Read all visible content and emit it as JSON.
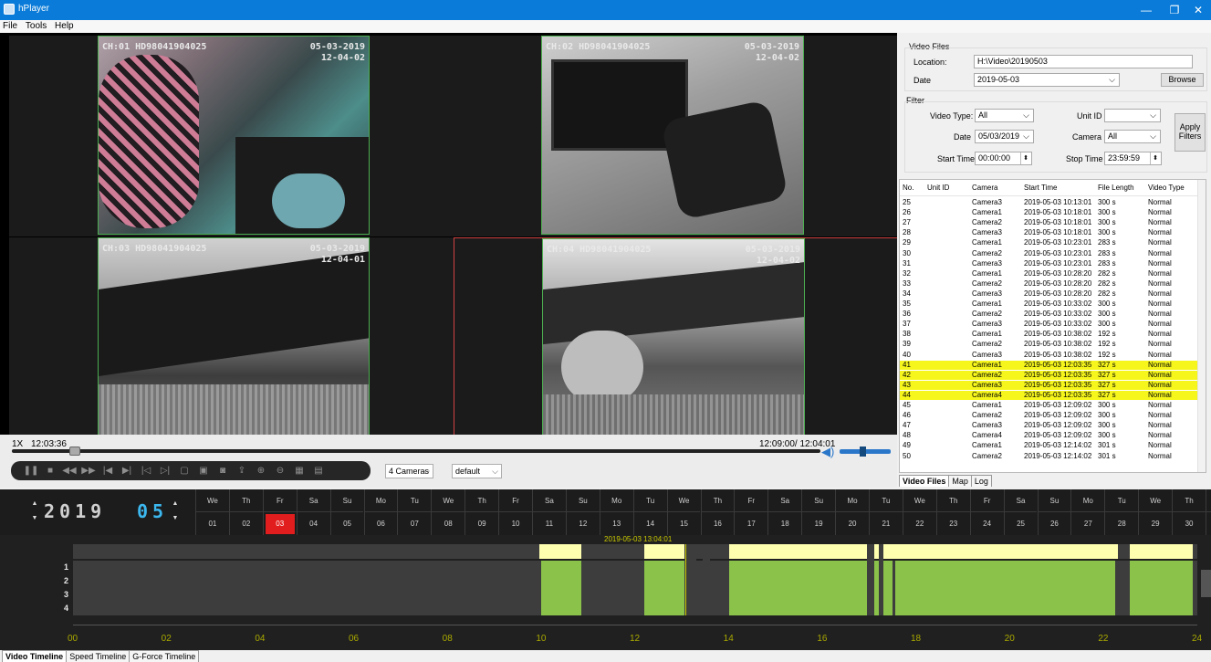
{
  "window": {
    "title": "hPlayer",
    "minimize": "—",
    "restore": "❐",
    "close": "✕"
  },
  "menu": [
    "File",
    "Tools",
    "Help"
  ],
  "cameras": [
    {
      "osd": "CH:01 HD98041904025",
      "date": "05-03-2019",
      "time": "12-04-02"
    },
    {
      "osd": "CH:02 HD98041904025",
      "date": "05-03-2019",
      "time": "12-04-02"
    },
    {
      "osd": "CH:03 HD98041904025",
      "date": "05-03-2019",
      "time": "12-04-01"
    },
    {
      "osd": "CH:04 HD98041904025",
      "date": "05-03-2019",
      "time": "12-04-02"
    }
  ],
  "playback": {
    "speed": "1X",
    "current_time": "12:03:36",
    "range": "12:09:00/ 12:04:01",
    "camera_mode": "4 Cameras",
    "layout": "default",
    "transport_icons": [
      "pause-icon",
      "stop-icon",
      "rewind-icon",
      "fast-forward-icon",
      "prev-file-icon",
      "next-file-icon",
      "step-back-icon",
      "step-forward-icon",
      "fullscreen-icon",
      "snapshot-icon",
      "camera-icon",
      "export-icon",
      "zoom-in-icon",
      "zoom-out-icon",
      "grid-icon",
      "settings-icon"
    ]
  },
  "video_files": {
    "section": "Video Files",
    "location_label": "Location:",
    "location_value": "H:\\Video\\20190503",
    "date_label": "Date",
    "date_value": "2019-05-03",
    "browse": "Browse"
  },
  "filter": {
    "section": "Filter",
    "video_type_label": "Video Type:",
    "video_type_value": "All",
    "unit_id_label": "Unit ID",
    "unit_id_value": "",
    "date_label": "Date",
    "date_value": "05/03/2019",
    "camera_label": "Camera",
    "camera_value": "All",
    "start_time_label": "Start Time",
    "start_time_value": "00:00:00",
    "stop_time_label": "Stop Time",
    "stop_time_value": "23:59:59",
    "apply": "Apply Filters"
  },
  "table": {
    "headers": [
      "No.",
      "Unit ID",
      "Camera",
      "Start Time",
      "File Length",
      "Video Type"
    ],
    "rows": [
      [
        "25",
        "",
        "Camera3",
        "2019-05-03 10:13:01",
        "300 s",
        "Normal"
      ],
      [
        "26",
        "",
        "Camera1",
        "2019-05-03 10:18:01",
        "300 s",
        "Normal"
      ],
      [
        "27",
        "",
        "Camera2",
        "2019-05-03 10:18:01",
        "300 s",
        "Normal"
      ],
      [
        "28",
        "",
        "Camera3",
        "2019-05-03 10:18:01",
        "300 s",
        "Normal"
      ],
      [
        "29",
        "",
        "Camera1",
        "2019-05-03 10:23:01",
        "283 s",
        "Normal"
      ],
      [
        "30",
        "",
        "Camera2",
        "2019-05-03 10:23:01",
        "283 s",
        "Normal"
      ],
      [
        "31",
        "",
        "Camera3",
        "2019-05-03 10:23:01",
        "283 s",
        "Normal"
      ],
      [
        "32",
        "",
        "Camera1",
        "2019-05-03 10:28:20",
        "282 s",
        "Normal"
      ],
      [
        "33",
        "",
        "Camera2",
        "2019-05-03 10:28:20",
        "282 s",
        "Normal"
      ],
      [
        "34",
        "",
        "Camera3",
        "2019-05-03 10:28:20",
        "282 s",
        "Normal"
      ],
      [
        "35",
        "",
        "Camera1",
        "2019-05-03 10:33:02",
        "300 s",
        "Normal"
      ],
      [
        "36",
        "",
        "Camera2",
        "2019-05-03 10:33:02",
        "300 s",
        "Normal"
      ],
      [
        "37",
        "",
        "Camera3",
        "2019-05-03 10:33:02",
        "300 s",
        "Normal"
      ],
      [
        "38",
        "",
        "Camera1",
        "2019-05-03 10:38:02",
        "192 s",
        "Normal"
      ],
      [
        "39",
        "",
        "Camera2",
        "2019-05-03 10:38:02",
        "192 s",
        "Normal"
      ],
      [
        "40",
        "",
        "Camera3",
        "2019-05-03 10:38:02",
        "192 s",
        "Normal"
      ],
      [
        "41",
        "",
        "Camera1",
        "2019-05-03 12:03:35",
        "327 s",
        "Normal"
      ],
      [
        "42",
        "",
        "Camera2",
        "2019-05-03 12:03:35",
        "327 s",
        "Normal"
      ],
      [
        "43",
        "",
        "Camera3",
        "2019-05-03 12:03:35",
        "327 s",
        "Normal"
      ],
      [
        "44",
        "",
        "Camera4",
        "2019-05-03 12:03:35",
        "327 s",
        "Normal"
      ],
      [
        "45",
        "",
        "Camera1",
        "2019-05-03 12:09:02",
        "300 s",
        "Normal"
      ],
      [
        "46",
        "",
        "Camera2",
        "2019-05-03 12:09:02",
        "300 s",
        "Normal"
      ],
      [
        "47",
        "",
        "Camera3",
        "2019-05-03 12:09:02",
        "300 s",
        "Normal"
      ],
      [
        "48",
        "",
        "Camera4",
        "2019-05-03 12:09:02",
        "300 s",
        "Normal"
      ],
      [
        "49",
        "",
        "Camera1",
        "2019-05-03 12:14:02",
        "301 s",
        "Normal"
      ],
      [
        "50",
        "",
        "Camera2",
        "2019-05-03 12:14:02",
        "301 s",
        "Normal"
      ]
    ],
    "highlighted": [
      "41",
      "42",
      "43",
      "44"
    ]
  },
  "right_tabs": [
    "Video Files",
    "Map",
    "Log"
  ],
  "calendar": {
    "year": "2019",
    "month": "05",
    "selected_day": "03",
    "weekdays": [
      "We",
      "Th",
      "Fr",
      "Sa",
      "Su",
      "Mo",
      "Tu",
      "We",
      "Th",
      "Fr",
      "Sa",
      "Su",
      "Mo",
      "Tu",
      "We",
      "Th",
      "Fr",
      "Sa",
      "Su",
      "Mo",
      "Tu",
      "We",
      "Th",
      "Fr",
      "Sa",
      "Su",
      "Mo",
      "Tu",
      "We",
      "Th",
      "Fr"
    ],
    "days": [
      "01",
      "02",
      "03",
      "04",
      "05",
      "06",
      "07",
      "08",
      "09",
      "10",
      "11",
      "12",
      "13",
      "14",
      "15",
      "16",
      "17",
      "18",
      "19",
      "20",
      "21",
      "22",
      "23",
      "24",
      "25",
      "26",
      "27",
      "28",
      "29",
      "30",
      "31"
    ]
  },
  "timeline": {
    "cursor_label": "2019-05-03 13:04:01",
    "lanes": [
      "1",
      "2",
      "3",
      "4"
    ],
    "hours": [
      "00",
      "02",
      "04",
      "06",
      "08",
      "10",
      "12",
      "14",
      "16",
      "18",
      "20",
      "22",
      "24"
    ],
    "recording_color": "#8bc34a",
    "event_color": "#ffffb0"
  },
  "bottom_tabs": [
    "Video Timeline",
    "Speed Timeline",
    "G-Force Timeline"
  ]
}
